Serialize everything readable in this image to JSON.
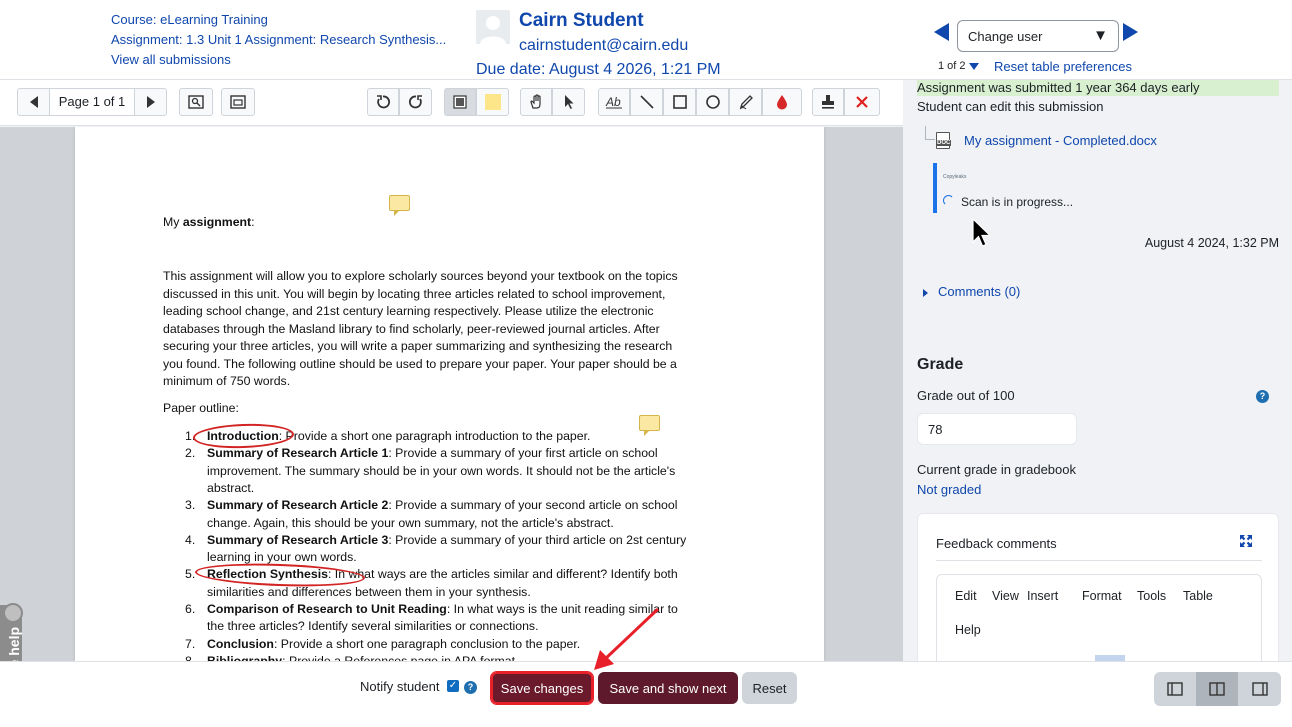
{
  "header": {
    "course": "Course: eLearning Training",
    "assignment": "Assignment: 1.3 Unit 1 Assignment: Research Synthesis...",
    "view_all": "View all submissions",
    "student_name": "Cairn Student",
    "student_email": "cairnstudent@cairn.edu",
    "due_date": "Due date: August 4 2026, 1:21 PM",
    "change_user": "Change user",
    "user_count": "1 of 2",
    "reset_prefs": "Reset table preferences"
  },
  "toolbar": {
    "page_indicator": "Page 1 of 1"
  },
  "document": {
    "heading_prefix": "My ",
    "heading_bold": "assignment",
    "heading_suffix": ":",
    "paragraph_lines": [
      "This assignment will allow you to explore scholarly sources beyond your textbook on the topics",
      "discussed in this unit. You will begin by locating three articles related to school improvement,",
      "leading school change, and 21st century learning respectively. Please utilize the electronic",
      "databases through the Masland library to find scholarly, peer-reviewed journal articles. After",
      "securing your three articles, you will write a paper summarizing and synthesizing the research",
      "you found. The following outline should be used to prepare your paper. Your paper should be a",
      "minimum of 750 words."
    ],
    "outline_label": "Paper outline:",
    "items": [
      {
        "num": "1.",
        "bold": "Introduction",
        "lines": [
          ": Provide a short one paragraph introduction to the paper."
        ]
      },
      {
        "num": "2.",
        "bold": "Summary of Research Article 1",
        "lines": [
          ": Provide a summary of your first article on school",
          "improvement. The summary should be in your own words. It should not be the article's",
          "abstract."
        ]
      },
      {
        "num": "3.",
        "bold": "Summary of Research Article 2",
        "lines": [
          ": Provide a summary of your second article on school",
          "change. Again, this should be your own summary, not the article's abstract."
        ]
      },
      {
        "num": "4.",
        "bold": "Summary of Research Article 3",
        "lines": [
          ": Provide a summary of your third article on 2st century",
          "learning in your own words."
        ]
      },
      {
        "num": "5.",
        "bold": "Reflection Synthesis",
        "lines": [
          ": In what ways are the articles similar and different? Identify both",
          "similarities and differences between them in your synthesis."
        ]
      },
      {
        "num": "6.",
        "bold": "Comparison of Research to Unit Reading",
        "lines": [
          ": In what ways is the unit reading similar to",
          "the three articles? Identify several similarities or connections."
        ]
      },
      {
        "num": "7.",
        "bold": "Conclusion",
        "lines": [
          ": Provide a short one paragraph conclusion to the paper."
        ]
      },
      {
        "num": "8.",
        "bold": "Bibliography",
        "lines": [
          ": Provide a References page in APA format."
        ]
      }
    ]
  },
  "live_help": "live help",
  "panel": {
    "early_banner": "Assignment was submitted 1 year 364 days early",
    "can_edit": "Student can edit this submission",
    "file_name": "My assignment - Completed.docx",
    "file_badge": "DOC",
    "scan_logo": "Copyleaks",
    "scan_status": "Scan is in progress...",
    "submitted_date": "August 4 2024, 1:32 PM",
    "comments": "Comments (0)",
    "grade_heading": "Grade",
    "grade_label": "Grade out of 100",
    "grade_value": "78",
    "gradebook_label": "Current grade in gradebook",
    "gradebook_value": "Not graded",
    "feedback_title": "Feedback comments",
    "editor_menu": [
      "Edit",
      "View",
      "Insert",
      "Format",
      "Tools",
      "Table",
      "Help"
    ]
  },
  "footer": {
    "notify_label": "Notify student",
    "save": "Save changes",
    "save_next": "Save and show next",
    "reset": "Reset"
  },
  "colors": {
    "link": "#0f47ad",
    "primary_button": "#6a1a2a",
    "annotation_red": "#e8202a"
  }
}
